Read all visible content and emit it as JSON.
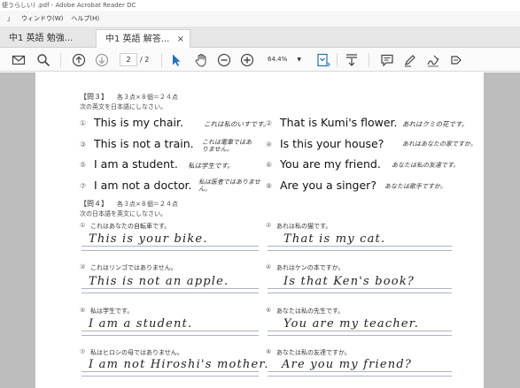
{
  "window": {
    "title": "便うらしい)  .pdf - Adobe Acrobat Reader DC"
  },
  "menu": {
    "items": [
      "」",
      "ウィンドウ(W)",
      "ヘルプ(H)"
    ]
  },
  "tabs": [
    {
      "label": "中1 英語 勉強..."
    },
    {
      "label": "中1 英語 解答...",
      "close": "×"
    }
  ],
  "toolbar": {
    "page_current": "2",
    "page_total": "/ 2",
    "zoom": "64.4%",
    "icons": [
      "mail-icon",
      "search-icon",
      "page-up-icon",
      "page-down-icon",
      "select-cursor-icon",
      "hand-icon",
      "zoom-out-icon",
      "zoom-in-icon",
      "fit-page-icon",
      "scroll-mode-icon",
      "comment-icon",
      "highlight-icon",
      "sign-icon",
      "share-icon"
    ],
    "accent": "#1a73c7"
  },
  "document": {
    "q3": {
      "header": "【問３】",
      "points": "各３点×８個＝２４点",
      "instruction": "次の英文を日本語にしなさい。",
      "items": [
        {
          "num": "①",
          "english": "This is my chair.",
          "answer": "これは私のいすです。"
        },
        {
          "num": "②",
          "english": "That is Kumi's flower.",
          "answer": "あれはクミの花です。"
        },
        {
          "num": "③",
          "english": "This is  not a train.",
          "answer": "これは電車ではありません。"
        },
        {
          "num": "④",
          "english": "Is this your house?",
          "answer": "あれはあなたの家ですか。"
        },
        {
          "num": "⑤",
          "english": "I am a student.",
          "answer": "私は学生です。"
        },
        {
          "num": "⑥",
          "english": "You are my friend.",
          "answer": "あなたは私の友達です。"
        },
        {
          "num": "⑦",
          "english": "I am not a doctor.",
          "answer": "私は医者ではありません。"
        },
        {
          "num": "⑧",
          "english": "Are you a singer?",
          "answer": "あなたは歌手ですか。"
        }
      ]
    },
    "q4": {
      "header": "【問４】",
      "points": "各３点×８個＝２４点",
      "instruction": "次の日本語を英文にしなさい。",
      "items": [
        {
          "num": "①",
          "prompt": "これはあなたの自転車です。",
          "answer": "This is your bike."
        },
        {
          "num": "②",
          "prompt": "あれは私の猫です。",
          "answer": "That is my cat."
        },
        {
          "num": "③",
          "prompt": "これはリンゴではありません。",
          "answer": "This is not an apple."
        },
        {
          "num": "④",
          "prompt": "あれはケンの本ですか。",
          "answer": "Is that Ken's book?"
        },
        {
          "num": "⑤",
          "prompt": "私は学生です。",
          "answer": "I am a student."
        },
        {
          "num": "⑥",
          "prompt": "あなたは私の先生です。",
          "answer": "You are my teacher."
        },
        {
          "num": "⑦",
          "prompt": "私はヒロシの母ではありません。",
          "answer": "I am not Hiroshi's mother."
        },
        {
          "num": "⑧",
          "prompt": "あなたは私の友達ですか。",
          "answer": "Are you my friend?"
        }
      ]
    }
  }
}
